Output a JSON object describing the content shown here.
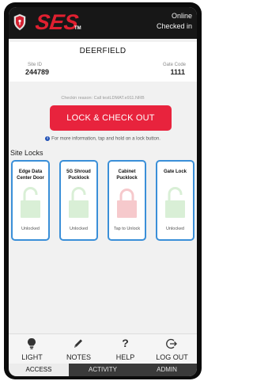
{
  "header": {
    "logo_text": "SES",
    "logo_tm": "TM",
    "status_online": "Online",
    "status_checked": "Checked in"
  },
  "site": {
    "name": "DEERFIELD",
    "site_id_label": "Site ID",
    "site_id": "244789",
    "gate_code_label": "Gate Code",
    "gate_code": "1111"
  },
  "checkin_reason": "Checkin reason:  Call testLDMAT.e911.NRB",
  "lock_button": "LOCK & CHECK OUT",
  "info_text": "For more information, tap and hold on a lock button.",
  "site_locks": {
    "title": "Site Locks",
    "items": [
      {
        "name": "Edge Data Center Door",
        "status": "Unlocked",
        "state_color": "#d9efd6"
      },
      {
        "name": "5G Shroud Pucklock",
        "status": "Unlocked",
        "state_color": "#d9efd6"
      },
      {
        "name": "Cabinet Pucklock",
        "status": "Tap to Unlock",
        "state_color": "#f6c9cc"
      },
      {
        "name": "Gate Lock",
        "status": "Unlocked",
        "state_color": "#d9efd6"
      }
    ]
  },
  "tabs": [
    {
      "label": "LIGHT",
      "icon": "bulb-icon"
    },
    {
      "label": "NOTES",
      "icon": "pencil-icon"
    },
    {
      "label": "HELP",
      "icon": "question-icon"
    },
    {
      "label": "LOG OUT",
      "icon": "logout-icon"
    }
  ],
  "bottom_nav": [
    {
      "label": "ACCESS",
      "active": true
    },
    {
      "label": "ACTIVITY",
      "active": false
    },
    {
      "label": "ADMIN",
      "active": false
    }
  ],
  "colors": {
    "brand_red": "#e8233d",
    "tile_border": "#3a8fd8",
    "unlocked_green": "#d9efd6",
    "locked_red": "#f6c9cc"
  }
}
